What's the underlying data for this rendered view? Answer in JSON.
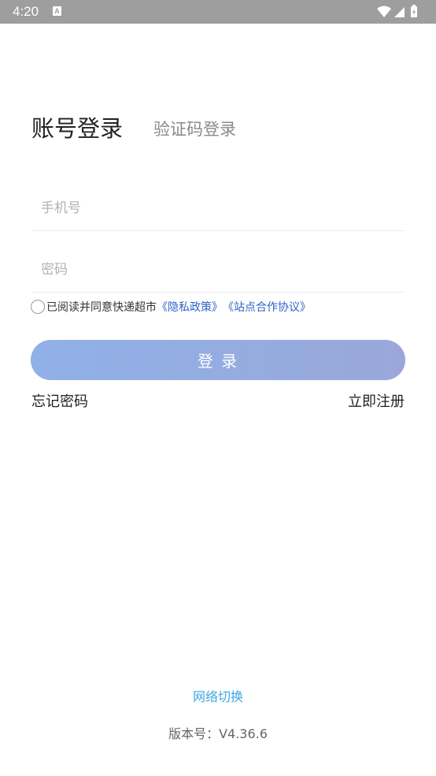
{
  "status_bar": {
    "time": "4:20",
    "notification_icon": "A",
    "icons": [
      "wifi-icon",
      "cell-signal-icon",
      "battery-icon"
    ]
  },
  "tabs": {
    "account_login": "账号登录",
    "code_login": "验证码登录"
  },
  "form": {
    "phone_placeholder": "手机号",
    "password_placeholder": "密码"
  },
  "agreement": {
    "checked": false,
    "text": "已阅读并同意快递超市",
    "privacy_link": "《隐私政策》",
    "cooperation_link": "《站点合作协议》"
  },
  "actions": {
    "login_label": "登 录",
    "forgot_password": "忘记密码",
    "register": "立即注册"
  },
  "footer": {
    "network_switch": "网络切换",
    "version": "版本号：V4.36.6"
  },
  "colors": {
    "status_bar": "#9e9e9e",
    "button_gradient_start": "#8fb1e8",
    "button_gradient_end": "#9aa7d9",
    "link": "#2f62c9",
    "network_link": "#3ea6e2"
  }
}
